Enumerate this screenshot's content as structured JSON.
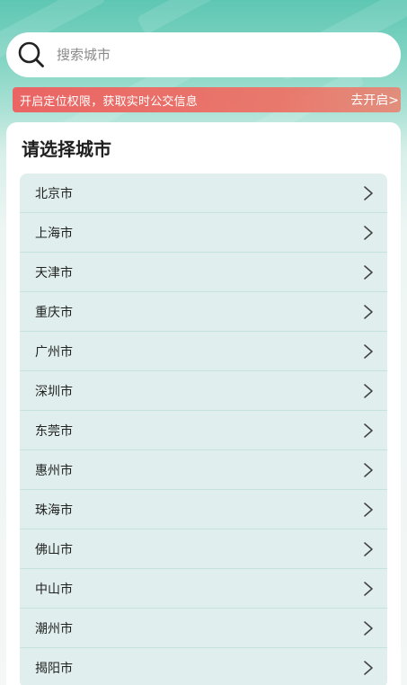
{
  "search": {
    "placeholder": "搜索城市"
  },
  "banner": {
    "text": "开启定位权限，获取实时公交信息",
    "action": "去开启>"
  },
  "panel": {
    "title": "请选择城市"
  },
  "cities": [
    "北京市",
    "上海市",
    "天津市",
    "重庆市",
    "广州市",
    "深圳市",
    "东莞市",
    "惠州市",
    "珠海市",
    "佛山市",
    "中山市",
    "潮州市",
    "揭阳市"
  ],
  "colors": {
    "accent": "#5ec7b3",
    "banner": "#ef6a63",
    "list_background": "#e0efed"
  }
}
